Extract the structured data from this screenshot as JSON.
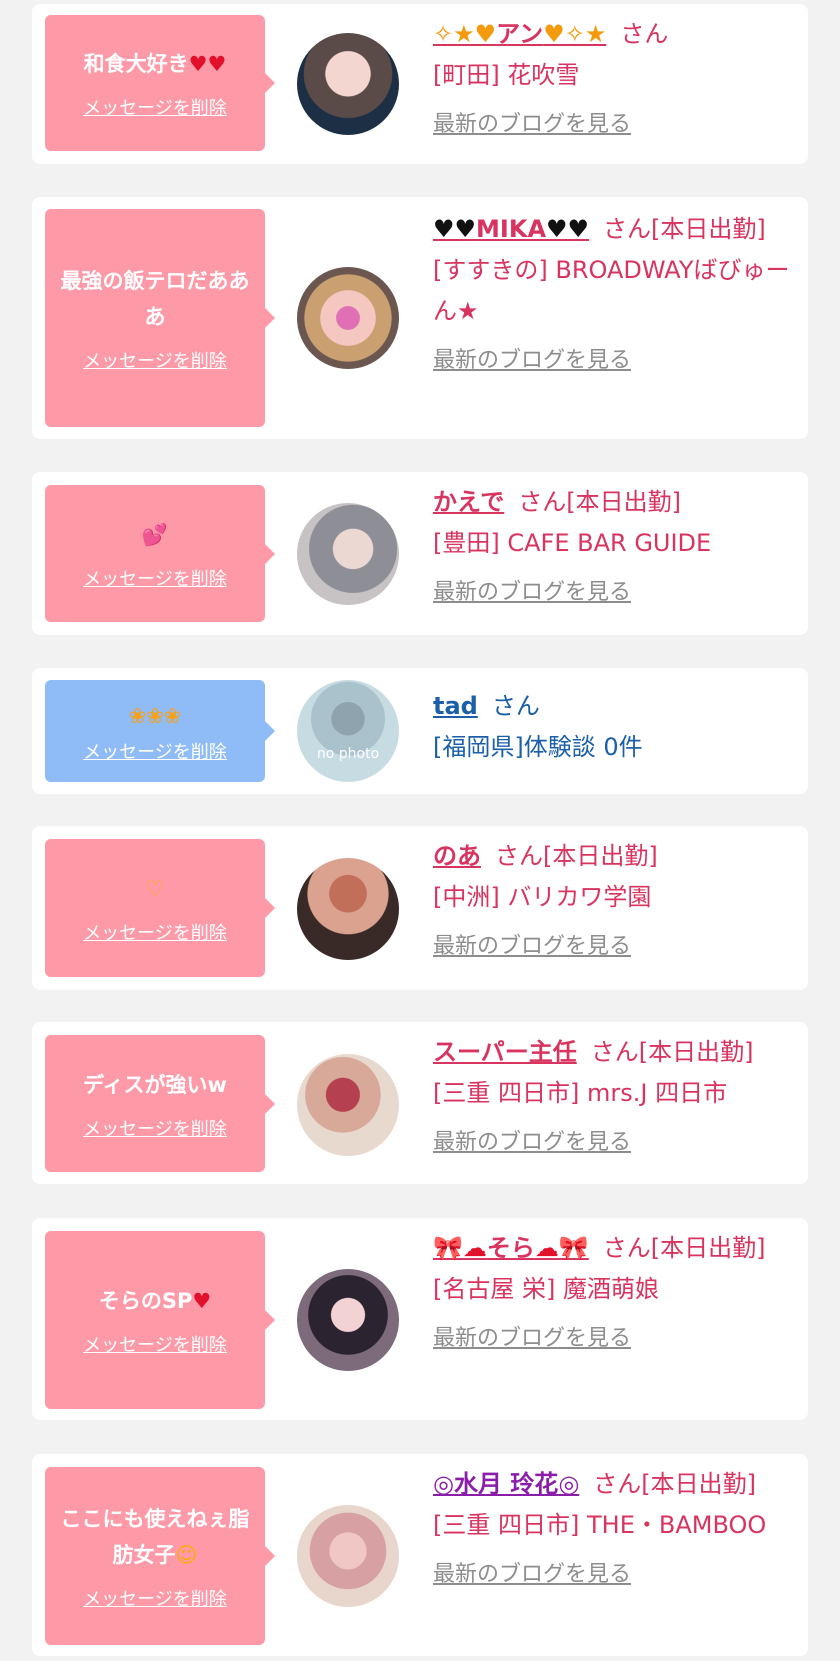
{
  "delete_label": "メッセージを削除",
  "san": "さん",
  "blog_link": "最新のブログを見る",
  "cards": [
    {
      "message": "和食大好き",
      "message_emoji": "♥♥",
      "name_prefix": "✧★♥",
      "name": "アン",
      "name_suffix": "♥✧★",
      "status": "",
      "shop": "[町田] 花吹雪"
    },
    {
      "message": "最強の飯テロだあああ",
      "message_emoji": "",
      "name_prefix": "♥♥",
      "name": "MIKA",
      "name_suffix": "♥♥",
      "status": "[本日出勤]",
      "shop": "[すすきの] BROADWAYばびゅーん★"
    },
    {
      "message": "",
      "message_emoji": "💕",
      "name_prefix": "",
      "name": "かえで",
      "name_suffix": "",
      "status": "[本日出勤]",
      "shop": "[豊田] CAFE BAR GUIDE"
    },
    {
      "message": "",
      "message_emoji": "❀❀❀",
      "name_prefix": "",
      "name": "tad",
      "name_suffix": "",
      "status": "",
      "shop": "[福岡県]体験談 0件",
      "avatar_text": "no photo"
    },
    {
      "message": "",
      "message_emoji": "♡",
      "name_prefix": "",
      "name": "のあ",
      "name_suffix": "",
      "status": "[本日出勤]",
      "shop": "[中洲] バリカワ学園"
    },
    {
      "message": "ディスが強いw",
      "message_emoji": "",
      "name_prefix": "",
      "name": "スーパー主任",
      "name_suffix": "",
      "status": "[本日出勤]",
      "shop": "[三重 四日市] mrs.J 四日市"
    },
    {
      "message": "そらのSP",
      "message_emoji": "♥",
      "name_prefix": "🎀☁",
      "name": "そら",
      "name_suffix": "☁🎀",
      "status": "[本日出勤]",
      "shop": "[名古屋 栄] 魔酒萌娘"
    },
    {
      "message": "ここにも使えねぇ脂肪女子",
      "message_emoji": "☺",
      "name_prefix": "◎",
      "name": "水月 玲花",
      "name_suffix": "◎",
      "status": "[本日出勤]",
      "shop": "[三重 四日市] THE・BAMBOO"
    }
  ]
}
